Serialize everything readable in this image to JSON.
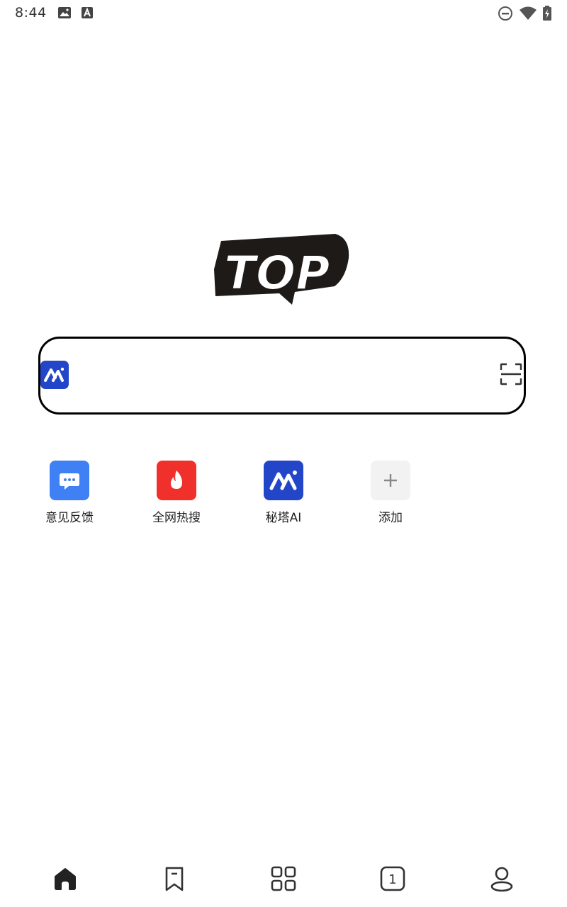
{
  "status_bar": {
    "time": "8:44",
    "left_icons": [
      "image-icon",
      "font-download-icon"
    ],
    "right_icons": [
      "do-not-disturb-icon",
      "wifi-icon",
      "battery-charging-icon"
    ]
  },
  "logo": {
    "text": "TOP"
  },
  "search": {
    "placeholder": "",
    "value": "",
    "left_badge": "mita-ai-icon",
    "right_icon": "scan-icon"
  },
  "shortcuts": [
    {
      "label": "意见反馈",
      "icon": "feedback-chat-icon",
      "color": "#3f80f5"
    },
    {
      "label": "全网热搜",
      "icon": "hot-fire-icon",
      "color": "#f0302b"
    },
    {
      "label": "秘塔AI",
      "icon": "mita-ai-icon",
      "color": "#2346c8"
    },
    {
      "label": "添加",
      "icon": "plus-icon",
      "color": "#f2f2f2"
    }
  ],
  "tab_bar": {
    "items": [
      {
        "name": "home",
        "icon": "home-icon",
        "active": true
      },
      {
        "name": "bookmarks",
        "icon": "bookmark-icon",
        "active": false
      },
      {
        "name": "apps",
        "icon": "grid-icon",
        "active": false
      },
      {
        "name": "tabs",
        "icon": "tabs-count-icon",
        "count": "1",
        "active": false
      },
      {
        "name": "profile",
        "icon": "profile-icon",
        "active": false
      }
    ]
  }
}
